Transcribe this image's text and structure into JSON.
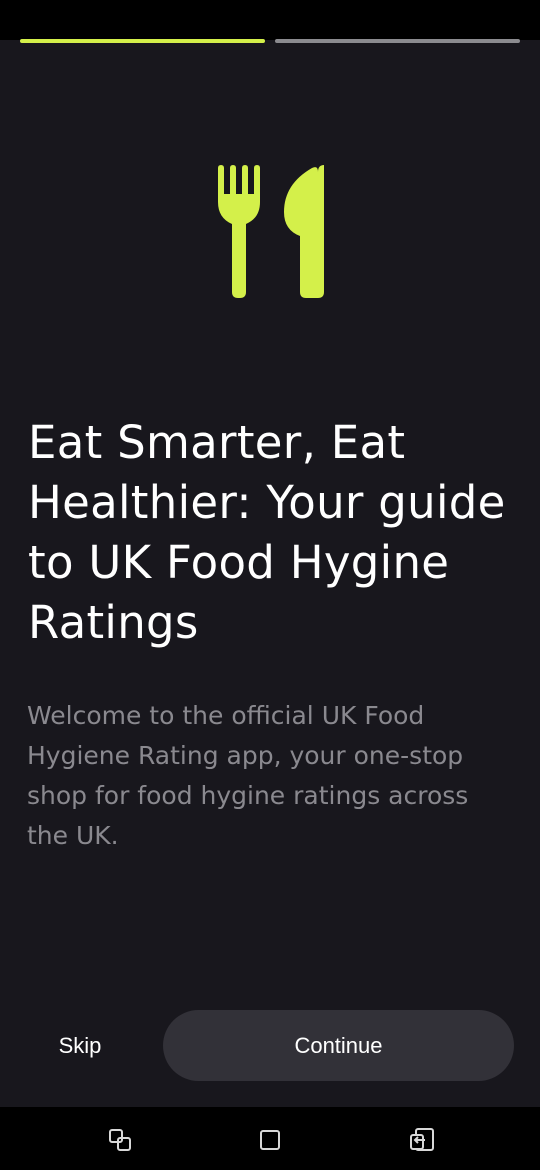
{
  "onboarding": {
    "progress": {
      "total_steps": 2,
      "current_step": 1
    },
    "hero_icon": "fork-knife-icon",
    "title": "Eat Smarter, Eat Healthier: Your guide to UK Food Hygine Ratings",
    "description": "Welcome to the official UK Food Hygiene Rating app, your one-stop shop for food hygine ratings across the UK.",
    "skip_label": "Skip",
    "continue_label": "Continue"
  },
  "system_nav": {
    "recents_icon": "recent-apps-icon",
    "home_icon": "home-icon",
    "back_icon": "back-icon"
  },
  "colors": {
    "background": "#18171d",
    "accent": "#d4f04a",
    "inactive_progress": "#8b8b8f",
    "button_bg": "#323138",
    "body_text": "#8a898f"
  }
}
